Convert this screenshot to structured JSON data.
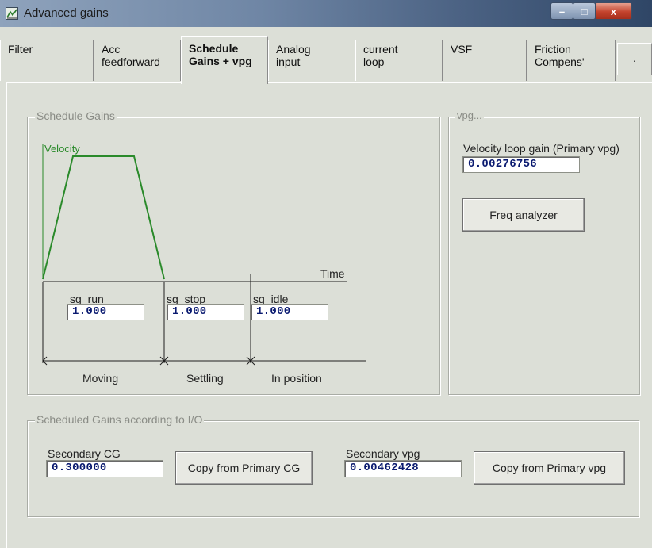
{
  "window": {
    "title": "Advanced gains",
    "minimize_glyph": "–",
    "maximize_glyph": "□",
    "close_glyph": "x"
  },
  "tabs": [
    {
      "label": "Filter"
    },
    {
      "label": "Acc\nfeedforward"
    },
    {
      "label": "Schedule\nGains + vpg"
    },
    {
      "label": "Analog\ninput"
    },
    {
      "label": "current\nloop"
    },
    {
      "label": "VSF"
    },
    {
      "label": "Friction\nCompens'"
    },
    {
      "label": "."
    }
  ],
  "schedule_gains": {
    "legend": "Schedule Gains",
    "diagram": {
      "velocity_label": "Velocity",
      "time_label": "Time",
      "phase_labels": [
        "Moving",
        "Settling",
        "In position"
      ]
    },
    "sg_run": {
      "label": "sg_run",
      "value": "1.000"
    },
    "sg_stop": {
      "label": "sg_stop",
      "value": "1.000"
    },
    "sg_idle": {
      "label": "sg_idle",
      "value": "1.000"
    }
  },
  "vpg": {
    "legend": "vpg...",
    "label": "Velocity loop gain (Primary vpg)",
    "value": "0.00276756",
    "freq_button": "Freq analyzer"
  },
  "scheduled_io": {
    "legend": "Scheduled Gains according to I/O",
    "secondary_cg": {
      "label": "Secondary CG",
      "value": "0.300000",
      "copy_button": "Copy from Primary CG"
    },
    "secondary_vpg": {
      "label": "Secondary vpg",
      "value": "0.00462428",
      "copy_button": "Copy from Primary vpg"
    }
  },
  "colors": {
    "velocity_line": "#2a8a2a",
    "field_text": "#0a1a70",
    "close_button": "#c3432d"
  }
}
